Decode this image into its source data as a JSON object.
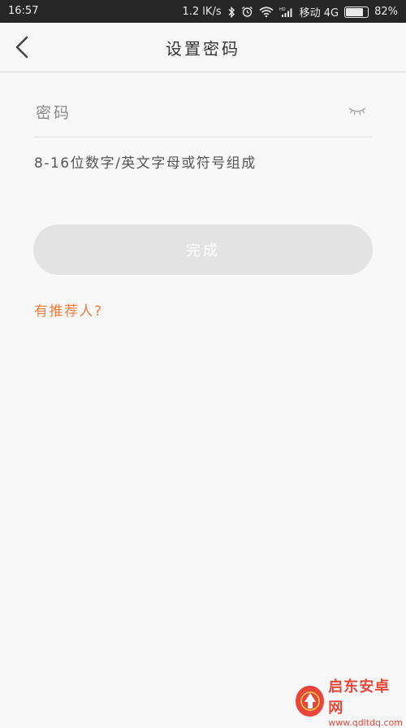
{
  "status_bar": {
    "time": "16:57",
    "speed": "1.2 lK/s",
    "carrier": "移动 4G",
    "battery_percent": "82%",
    "battery_level": 0.82
  },
  "header": {
    "title": "设置密码",
    "back_icon": "chevron-left-icon"
  },
  "form": {
    "password_placeholder": "密码",
    "password_value": "",
    "eye_icon": "eye-closed-icon",
    "hint": "8-16位数字/英文字母或符号组成",
    "done_label": "完成",
    "referrer_label": "有推荐人?"
  },
  "watermark": {
    "brand": "启东安卓网",
    "url": "www.qdltdq.com"
  },
  "colors": {
    "accent": "#f07d3c",
    "button_disabled": "#e3e3e3",
    "status_bg": "#262626",
    "watermark": "#e9463a"
  }
}
